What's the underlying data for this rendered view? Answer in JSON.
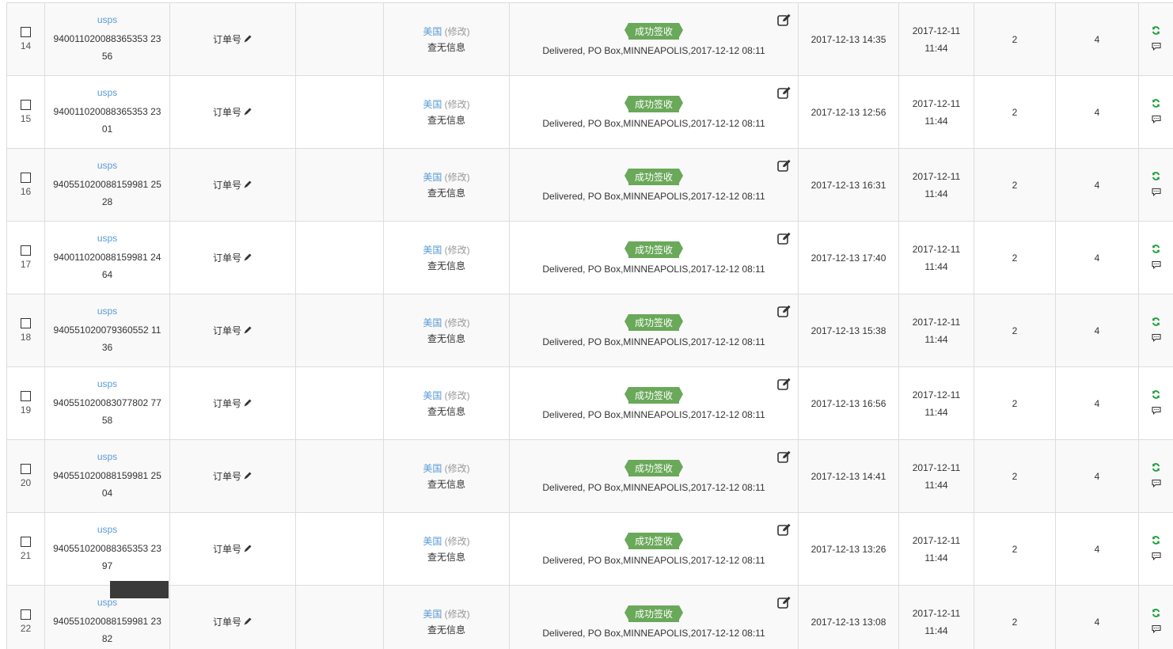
{
  "labels": {
    "order_number": "订单号",
    "country": "美国",
    "modify": "(修改)",
    "no_info": "查无信息",
    "status_badge": "成功签收",
    "created_date": "2017-12-11",
    "created_time": "11:44"
  },
  "colors": {
    "badge": "#6aa85a",
    "link": "#5b9bd5",
    "refresh": "#1e9e3a"
  },
  "icons": {
    "edit": "edit-icon",
    "pencil": "pencil-icon",
    "refresh": "refresh-icon",
    "comment": "comment-icon"
  },
  "rows": [
    {
      "index": "14",
      "carrier": "usps",
      "track_a": "940011020088365353 23",
      "track_b": "56",
      "status_text": "Delivered, PO Box,MINNEAPOLIS,2017-12-12 08:11",
      "updated": "2017-12-13 14:35",
      "count_a": "2",
      "count_b": "4"
    },
    {
      "index": "15",
      "carrier": "usps",
      "track_a": "940011020088365353 23",
      "track_b": "01",
      "status_text": "Delivered, PO Box,MINNEAPOLIS,2017-12-12 08:11",
      "updated": "2017-12-13 12:56",
      "count_a": "2",
      "count_b": "4"
    },
    {
      "index": "16",
      "carrier": "usps",
      "track_a": "940551020088159981 25",
      "track_b": "28",
      "status_text": "Delivered, PO Box,MINNEAPOLIS,2017-12-12 08:11",
      "updated": "2017-12-13 16:31",
      "count_a": "2",
      "count_b": "4"
    },
    {
      "index": "17",
      "carrier": "usps",
      "track_a": "940011020088159981 24",
      "track_b": "64",
      "status_text": "Delivered, PO Box,MINNEAPOLIS,2017-12-12 08:11",
      "updated": "2017-12-13 17:40",
      "count_a": "2",
      "count_b": "4"
    },
    {
      "index": "18",
      "carrier": "usps",
      "track_a": "940551020079360552 11",
      "track_b": "36",
      "status_text": "Delivered, PO Box,MINNEAPOLIS,2017-12-12 08:11",
      "updated": "2017-12-13 15:38",
      "count_a": "2",
      "count_b": "4"
    },
    {
      "index": "19",
      "carrier": "usps",
      "track_a": "940551020083077802 77",
      "track_b": "58",
      "status_text": "Delivered, PO Box,MINNEAPOLIS,2017-12-12 08:11",
      "updated": "2017-12-13 16:56",
      "count_a": "2",
      "count_b": "4"
    },
    {
      "index": "20",
      "carrier": "usps",
      "track_a": "940551020088159981 25",
      "track_b": "04",
      "status_text": "Delivered, PO Box,MINNEAPOLIS,2017-12-12 08:11",
      "updated": "2017-12-13 14:41",
      "count_a": "2",
      "count_b": "4"
    },
    {
      "index": "21",
      "carrier": "usps",
      "track_a": "940551020088365353 23",
      "track_b": "97",
      "status_text": "Delivered, PO Box,MINNEAPOLIS,2017-12-12 08:11",
      "updated": "2017-12-13 13:26",
      "count_a": "2",
      "count_b": "4"
    },
    {
      "index": "22",
      "carrier": "usps",
      "track_a": "940551020088159981 23",
      "track_b": "82",
      "status_text": "Delivered, PO Box,MINNEAPOLIS,2017-12-12 08:11",
      "updated": "2017-12-13 13:08",
      "count_a": "2",
      "count_b": "4"
    }
  ]
}
